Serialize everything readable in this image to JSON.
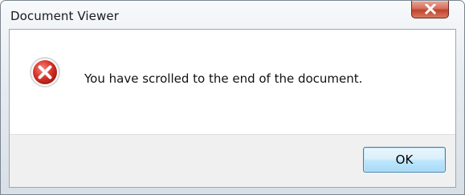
{
  "window": {
    "title": "Document Viewer"
  },
  "dialog": {
    "icon": "error-icon",
    "message": "You have scrolled to the end of the document.",
    "ok_label": "OK"
  },
  "colors": {
    "close_button": "#c0432d",
    "error_icon": "#d22a1f",
    "ok_border": "#3c7fb1",
    "button_area": "#f0f0f0"
  }
}
